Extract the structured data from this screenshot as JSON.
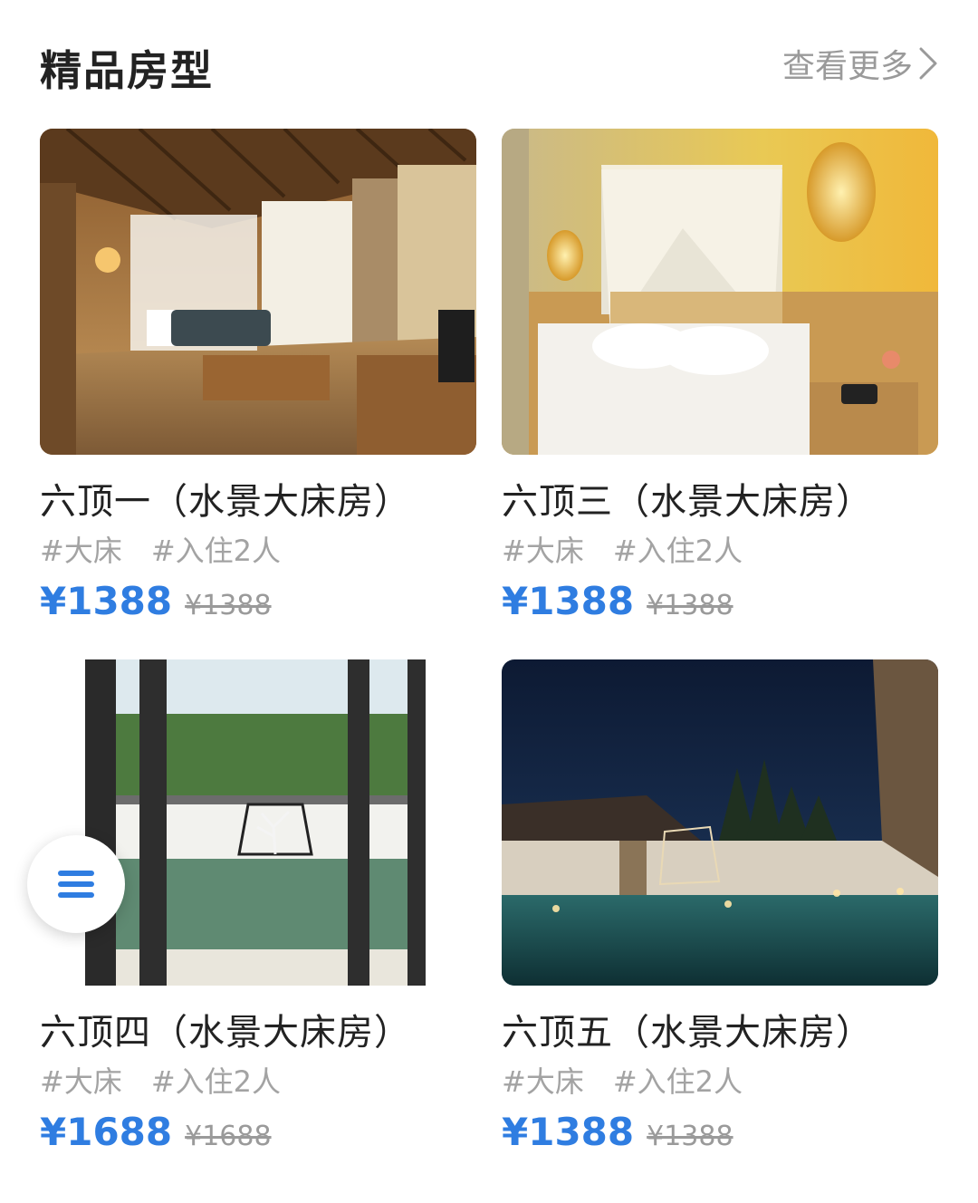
{
  "header": {
    "title": "精品房型",
    "more_label": "查看更多"
  },
  "rooms": [
    {
      "name": "六顶一（水景大床房）",
      "tags": [
        "#大床",
        "#入住2人"
      ],
      "price": "¥1388",
      "original_price": "¥1388",
      "photo": "room-interior-canopy-bed-sofa-photo"
    },
    {
      "name": "六顶三（水景大床房）",
      "tags": [
        "#大床",
        "#入住2人"
      ],
      "price": "¥1388",
      "original_price": "¥1388",
      "photo": "canopy-bed-lanterns-photo"
    },
    {
      "name": "六顶四（水景大床房）",
      "tags": [
        "#大床",
        "#入住2人"
      ],
      "price": "¥1688",
      "original_price": "¥1688",
      "photo": "window-view-water-courtyard-photo"
    },
    {
      "name": "六顶五（水景大床房）",
      "tags": [
        "#大床",
        "#入住2人"
      ],
      "price": "¥1388",
      "original_price": "¥1388",
      "photo": "night-pool-courtyard-photo"
    }
  ],
  "menu_button": {
    "icon": "menu-icon"
  },
  "colors": {
    "accent": "#2f7de1",
    "title": "#222222",
    "muted": "#a3a3a3"
  }
}
